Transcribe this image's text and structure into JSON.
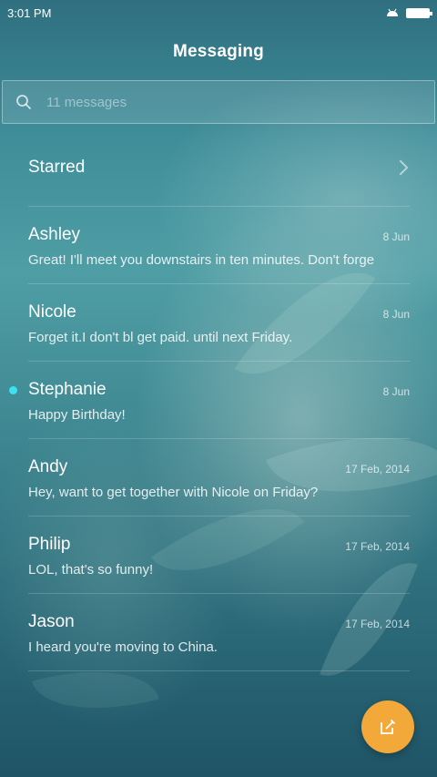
{
  "status_bar": {
    "time": "3:01 PM",
    "icons": [
      "android-icon",
      "battery-icon"
    ]
  },
  "header": {
    "title": "Messaging"
  },
  "search": {
    "placeholder": "11 messages",
    "icon": "search-icon"
  },
  "starred": {
    "label": "Starred",
    "icon": "chevron-right-icon"
  },
  "messages": [
    {
      "name": "Ashley",
      "date": "8 Jun",
      "preview": "Great! I'll meet you downstairs in ten minutes. Don't forge",
      "unread": false
    },
    {
      "name": "Nicole",
      "date": "8 Jun",
      "preview": "Forget it.I don't bl get paid. until next Friday.",
      "unread": false
    },
    {
      "name": "Stephanie",
      "date": "8 Jun",
      "preview": "Happy Birthday!",
      "unread": true
    },
    {
      "name": "Andy",
      "date": "17 Feb, 2014",
      "preview": "Hey, want to get together with Nicole on Friday?",
      "unread": false
    },
    {
      "name": "Philip",
      "date": "17 Feb, 2014",
      "preview": "LOL, that's so funny!",
      "unread": false
    },
    {
      "name": "Jason",
      "date": "17 Feb, 2014",
      "preview": "I heard you're moving to China.",
      "unread": false
    }
  ],
  "compose": {
    "icon": "compose-icon"
  },
  "colors": {
    "accent_fab": "#f3a93a",
    "unread_dot": "#3fe0f0"
  }
}
